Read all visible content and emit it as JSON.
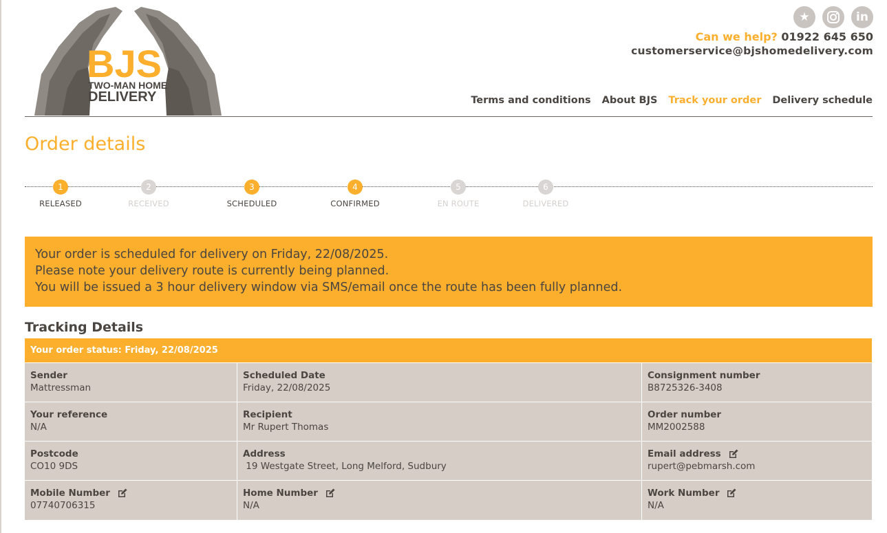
{
  "brand": {
    "logo_line1": "BJS",
    "logo_line2": "TWO-MAN HOME",
    "logo_line3": "DELIVERY",
    "accent_color": "#fbaf2d",
    "text_color": "#4a4540",
    "panel_color": "#d7cdc7"
  },
  "header": {
    "social": [
      {
        "icon": "star-icon",
        "glyph": "★"
      },
      {
        "icon": "instagram-icon",
        "glyph": ""
      },
      {
        "icon": "linkedin-icon",
        "glyph": "in"
      }
    ],
    "help_label": "Can we help?",
    "phone": "01922 645 650",
    "email": "customerservice@bjshomedelivery.com"
  },
  "nav": {
    "items": [
      {
        "label": "Terms and conditions",
        "active": false
      },
      {
        "label": "About BJS",
        "active": false
      },
      {
        "label": "Track your order",
        "active": true
      },
      {
        "label": "Delivery schedule",
        "active": false
      }
    ]
  },
  "page": {
    "title": "Order details"
  },
  "progress": {
    "steps": [
      {
        "number": "1",
        "label": "RELEASED",
        "done": true
      },
      {
        "number": "2",
        "label": "RECEIVED",
        "done": false
      },
      {
        "number": "3",
        "label": "SCHEDULED",
        "done": true
      },
      {
        "number": "4",
        "label": "CONFIRMED",
        "done": true
      },
      {
        "number": "5",
        "label": "EN ROUTE",
        "done": false
      },
      {
        "number": "6",
        "label": "DELIVERED",
        "done": false
      }
    ]
  },
  "notice": {
    "line1": "Your order is scheduled for delivery on Friday, 22/08/2025.",
    "line2": "Please note your delivery route is currently being planned.",
    "line3": "You will be issued a 3 hour delivery window via SMS/email once the route has been fully planned."
  },
  "tracking": {
    "section_title": "Tracking Details",
    "status": "Your order status: Friday, 22/08/2025",
    "rows": [
      [
        {
          "label": "Sender",
          "value": "Mattressman",
          "editable": false
        },
        {
          "label": "Scheduled Date",
          "value": "Friday, 22/08/2025",
          "editable": false
        },
        {
          "label": "Consignment number",
          "value": "B8725326-3408",
          "editable": false
        }
      ],
      [
        {
          "label": "Your reference",
          "value": "N/A",
          "editable": false
        },
        {
          "label": "Recipient",
          "value": "Mr Rupert Thomas",
          "editable": false
        },
        {
          "label": "Order number",
          "value": "MM2002588",
          "editable": false
        }
      ],
      [
        {
          "label": "Postcode",
          "value": "CO10 9DS",
          "editable": false
        },
        {
          "label": "Address",
          "value": " 19 Westgate Street, Long Melford, Sudbury",
          "editable": false
        },
        {
          "label": "Email address",
          "value": "rupert@pebmarsh.com",
          "editable": true
        }
      ],
      [
        {
          "label": "Mobile Number",
          "value": "07740706315",
          "editable": true
        },
        {
          "label": "Home Number",
          "value": "N/A",
          "editable": true
        },
        {
          "label": "Work Number",
          "value": "N/A",
          "editable": true
        }
      ]
    ]
  }
}
